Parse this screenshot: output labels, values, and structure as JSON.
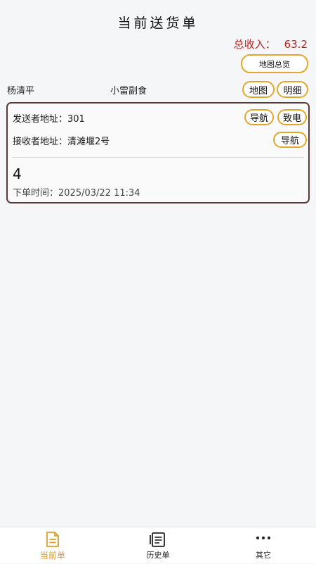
{
  "header": {
    "title": "当前送货单"
  },
  "summary": {
    "income_label": "总收入：",
    "income_value": "63.2",
    "map_overview_label": "地图总览"
  },
  "customer": {
    "name": "杨清平",
    "shop": "小雷副食",
    "map_label": "地图",
    "detail_label": "明细"
  },
  "order": {
    "sender_label": "发送者地址：",
    "sender_address": "301",
    "receiver_label": "接收者地址：",
    "receiver_address": "清滩堰2号",
    "nav_label": "导航",
    "call_label": "致电",
    "number": "4",
    "time_label": "下单时间：",
    "time_value": "2025/03/22 11:34"
  },
  "tabs": [
    {
      "label": "当前单",
      "icon": "document-icon",
      "active": true
    },
    {
      "label": "历史单",
      "icon": "history-stack-icon",
      "active": false
    },
    {
      "label": "其它",
      "icon": "more-dots-icon",
      "active": false
    }
  ],
  "colors": {
    "accent": "#e2a82a",
    "income": "#c0201e",
    "card_border": "#5a3a3a",
    "active_tab": "#e39b2b"
  }
}
